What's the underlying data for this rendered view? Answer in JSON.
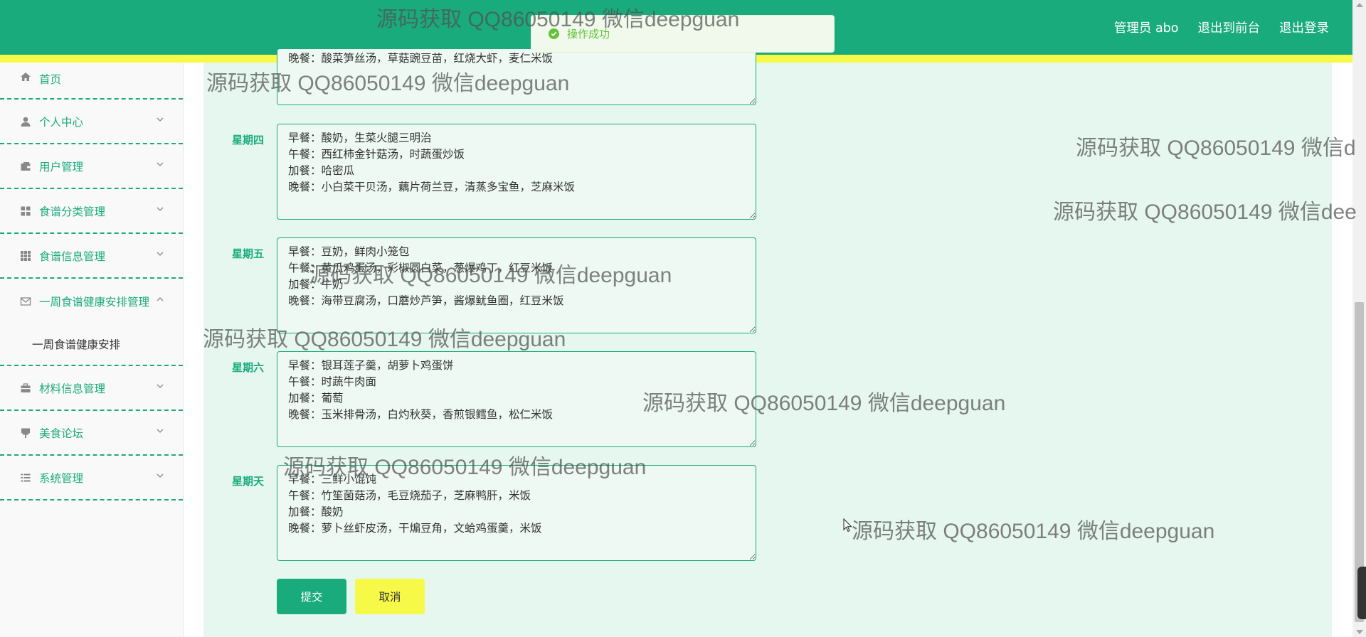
{
  "header": {
    "links": [
      "管理员 abo",
      "退出到前台",
      "退出登录"
    ],
    "accent_color": "#1aab7d",
    "stripe_color": "#f7f948"
  },
  "toast": {
    "text": "操作成功",
    "icon": "check-circle-icon"
  },
  "sidebar": {
    "items": [
      {
        "label": "首页",
        "icon": "home-icon"
      },
      {
        "label": "个人中心",
        "icon": "user-icon"
      },
      {
        "label": "用户管理",
        "icon": "wallet-icon"
      },
      {
        "label": "食谱分类管理",
        "icon": "grid-icon"
      },
      {
        "label": "食谱信息管理",
        "icon": "apps-icon"
      },
      {
        "label": "一周食谱健康安排管理",
        "icon": "mail-icon",
        "expanded": true,
        "children": [
          "一周食谱健康安排"
        ]
      },
      {
        "label": "材料信息管理",
        "icon": "briefcase-icon"
      },
      {
        "label": "美食论坛",
        "icon": "sign-icon"
      },
      {
        "label": "系统管理",
        "icon": "list-icon"
      }
    ]
  },
  "form": {
    "partial_top_line": "晚餐：酸菜笋丝汤，草菇豌豆苗，红烧大虾，麦仁米饭",
    "days": [
      {
        "label": "星期四",
        "lines": [
          "早餐：酸奶，生菜火腿三明治",
          "午餐：西红柿金针菇汤，时蔬蛋炒饭",
          "加餐：哈密瓜",
          "晚餐：小白菜干贝汤，藕片荷兰豆，清蒸多宝鱼，芝麻米饭"
        ]
      },
      {
        "label": "星期五",
        "lines": [
          "早餐：豆奶，鲜肉小笼包",
          "午餐：黄瓜鸡蛋汤，彩椒圆白菜，葱爆鸡丁，红豆米饭",
          "加餐：牛奶",
          "晚餐：海带豆腐汤，口蘑炒芦笋，酱爆鱿鱼圈，红豆米饭"
        ]
      },
      {
        "label": "星期六",
        "lines": [
          "早餐：银耳莲子羹，胡萝卜鸡蛋饼",
          "午餐：时蔬牛肉面",
          "加餐：葡萄",
          "晚餐：玉米排骨汤，白灼秋葵，香煎银鳕鱼，松仁米饭"
        ]
      },
      {
        "label": "星期天",
        "lines": [
          "早餐：三鲜小馄饨",
          "午餐：竹笙菌菇汤，毛豆烧茄子，芝麻鸭肝，米饭",
          "加餐：酸奶",
          "晚餐：萝卜丝虾皮汤，干煸豆角，文蛤鸡蛋羹，米饭"
        ]
      }
    ],
    "submit_label": "提交",
    "cancel_label": "取消"
  },
  "watermark": "源码获取 QQ86050149 微信deepguan",
  "watermark_clipped": "源码获取 QQ86050149 微信d",
  "watermark_clipped2": "源码获取 QQ86050149 微信dee"
}
